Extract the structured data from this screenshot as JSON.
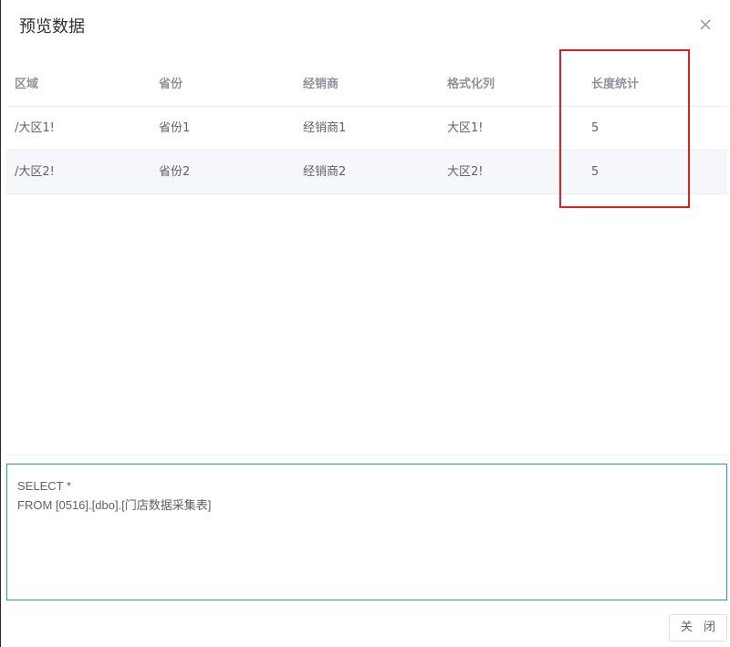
{
  "dialog": {
    "title": "预览数据",
    "close_button_label": "关 闭"
  },
  "table": {
    "columns": [
      "区域",
      "省份",
      "经销商",
      "格式化列",
      "长度统计"
    ],
    "rows": [
      [
        "/大区1!",
        "省份1",
        "经销商1",
        "大区1!",
        "5"
      ],
      [
        "/大区2!",
        "省份2",
        "经销商2",
        "大区2!",
        "5"
      ]
    ]
  },
  "sql": {
    "lines": [
      "SELECT *",
      "FROM [0516].[dbo].[门店数据采集表]"
    ]
  },
  "colors": {
    "highlight": "#e02020",
    "editor_border": "#1fa2b0",
    "stripe": "#f6f7fa"
  },
  "icons": {
    "close": "close-icon"
  }
}
